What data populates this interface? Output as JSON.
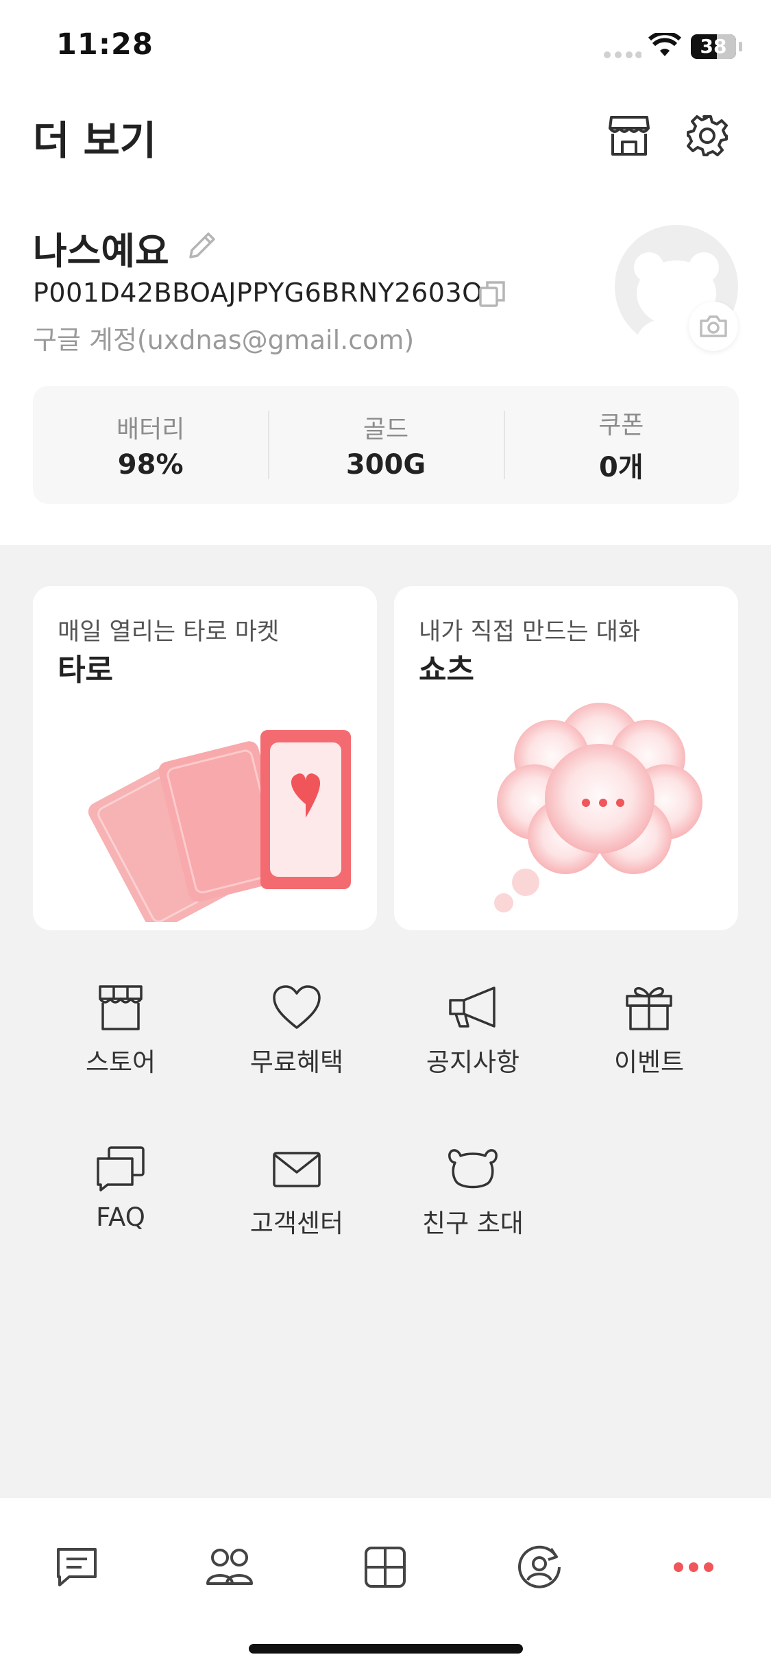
{
  "status_bar": {
    "time": "11:28",
    "battery": "38"
  },
  "header": {
    "title": "더 보기",
    "store_icon": "store-icon",
    "settings_icon": "gear-icon"
  },
  "profile": {
    "name": "나스예요",
    "user_id": "P001D42BBOAJPPYG6BRNY2603O",
    "account": "구글 계정(uxdnas@gmail.com)"
  },
  "stats": [
    {
      "label": "배터리",
      "value": "98%"
    },
    {
      "label": "골드",
      "value": "300G"
    },
    {
      "label": "쿠폰",
      "value": "0개"
    }
  ],
  "cards": [
    {
      "subtitle": "매일 열리는 타로 마켓",
      "title": "타로"
    },
    {
      "subtitle": "내가 직접 만드는 대화",
      "title": "쇼츠"
    }
  ],
  "menu": [
    {
      "label": "스토어",
      "icon": "store-icon"
    },
    {
      "label": "무료혜택",
      "icon": "heart-icon"
    },
    {
      "label": "공지사항",
      "icon": "megaphone-icon"
    },
    {
      "label": "이벤트",
      "icon": "gift-icon"
    },
    {
      "label": "FAQ",
      "icon": "chat-bubbles-icon"
    },
    {
      "label": "고객센터",
      "icon": "mail-icon"
    },
    {
      "label": "친구 초대",
      "icon": "bear-icon"
    }
  ],
  "tabs": [
    {
      "icon": "chat-icon"
    },
    {
      "icon": "friends-icon"
    },
    {
      "icon": "grid-icon"
    },
    {
      "icon": "profile-refresh-icon"
    },
    {
      "icon": "more-icon",
      "active": true
    }
  ],
  "colors": {
    "accent": "#f0555a",
    "card_pink": "#f7a3a6"
  }
}
